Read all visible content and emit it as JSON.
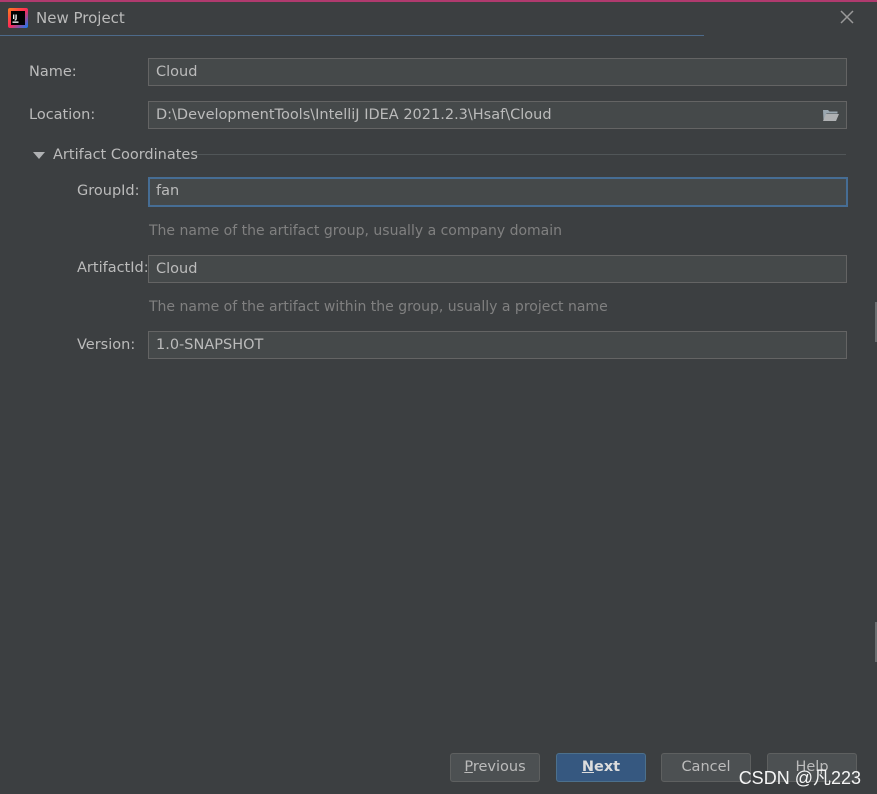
{
  "window": {
    "title": "New Project",
    "accent_color": "#b03a6e"
  },
  "form": {
    "name_label": "Name:",
    "name_value": "Cloud",
    "location_label": "Location:",
    "location_value": "D:\\DevelopmentTools\\IntelliJ IDEA 2021.2.3\\Hsaf\\Cloud",
    "section_title": "Artifact Coordinates",
    "groupid_label": "GroupId:",
    "groupid_value": "fan",
    "groupid_hint": "The name of the artifact group, usually a company domain",
    "artifactid_label": "ArtifactId:",
    "artifactid_value": "Cloud",
    "artifactid_hint": "The name of the artifact within the group, usually a project name",
    "version_label": "Version:",
    "version_value": "1.0-SNAPSHOT"
  },
  "buttons": {
    "previous_mnemonic": "P",
    "previous_rest": "revious",
    "next_mnemonic": "N",
    "next_rest": "ext",
    "cancel": "Cancel",
    "help": "Help"
  },
  "icons": {
    "app": "intellij-idea-icon",
    "close": "close-icon",
    "folder": "folder-open-icon",
    "expand": "triangle-down-icon"
  },
  "watermark": "CSDN @凡223"
}
